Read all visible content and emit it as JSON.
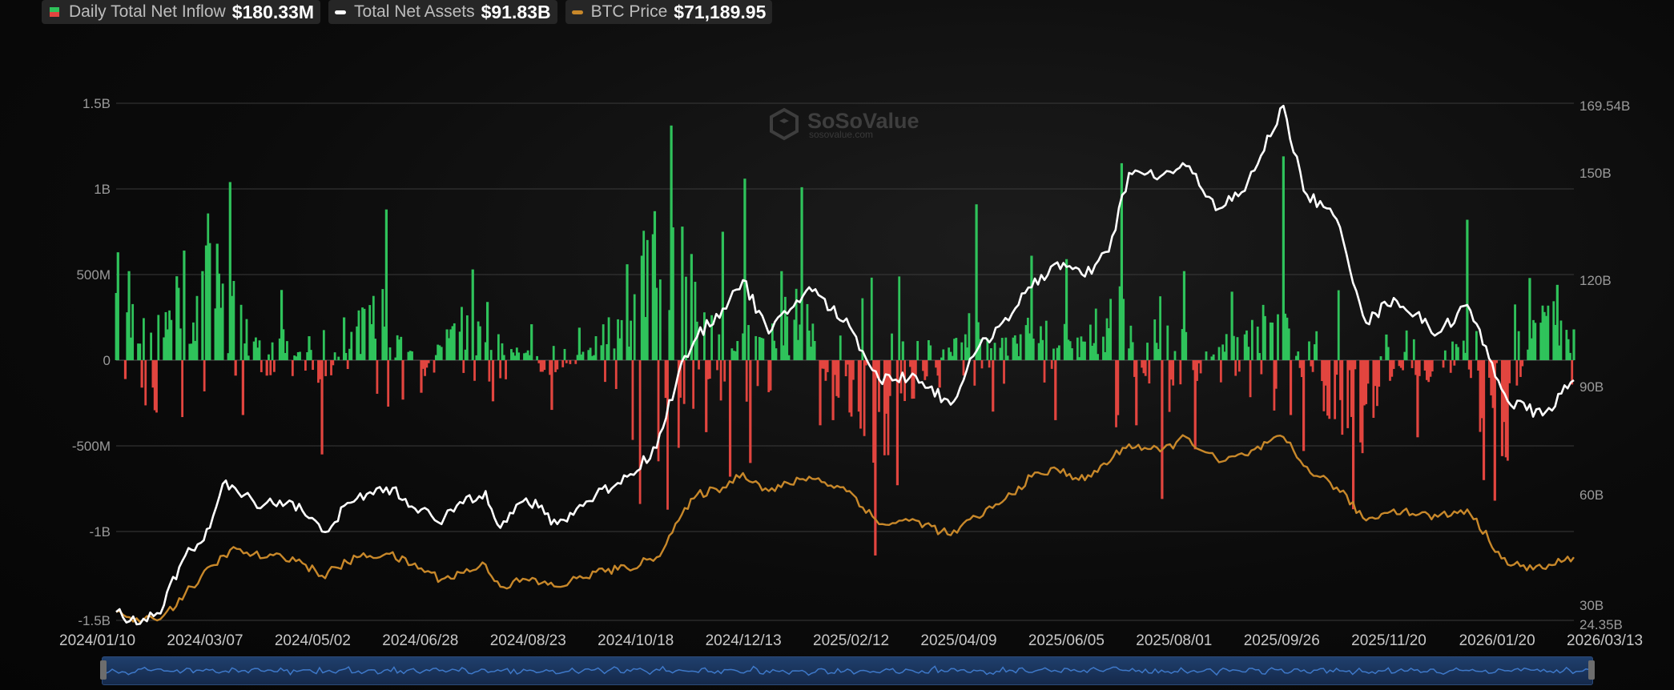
{
  "legend": {
    "inflow_label": "Daily Total Net Inflow",
    "inflow_value": "$180.33M",
    "assets_label": "Total Net Assets",
    "assets_value": "$91.83B",
    "btc_label": "BTC Price",
    "btc_value": "$71,189.95"
  },
  "watermark": {
    "brand": "SoSoValue",
    "site": "sosovalue.com"
  },
  "colors": {
    "positive": "#2fc35b",
    "negative": "#e2453f",
    "assets_line": "#ffffff",
    "btc_line": "#c8882a",
    "grid": "#3a3a3a",
    "navigator": "#1e3c6b"
  },
  "chart_data": {
    "type": "bar",
    "x_axis": {
      "type": "date",
      "range": [
        "2024-01-10",
        "2026-03-13"
      ],
      "tick_labels": [
        "2024/01/10",
        "2024/03/07",
        "2024/05/02",
        "2024/06/28",
        "2024/08/23",
        "2024/10/18",
        "2024/12/13",
        "2025/02/12",
        "2025/04/09",
        "2025/06/05",
        "2025/08/01",
        "2025/09/26",
        "2025/11/20",
        "2026/01/20",
        "2026/03/13"
      ]
    },
    "y_left": {
      "tick_labels": [
        "1.5B",
        "1B",
        "500M",
        "0",
        "-500M",
        "-1B",
        "-1.5B"
      ],
      "range": [
        -1500000000,
        1500000000
      ],
      "unit": "USD"
    },
    "y_right": {
      "tick_labels": [
        "169.54B",
        "150B",
        "120B",
        "90B",
        "60B",
        "30B",
        "24.35B"
      ],
      "range": [
        24.35,
        169.54
      ],
      "unit": "B USD"
    },
    "grid": true,
    "legend_position": "top-left",
    "series": [
      {
        "name": "Daily Total Net Inflow",
        "kind": "bar",
        "axis": "left",
        "unit": "USD M",
        "points": [
          [
            "2024-01-11",
            630
          ],
          [
            "2024-01-15",
            -110
          ],
          [
            "2024-01-17",
            520
          ],
          [
            "2024-01-24",
            -160
          ],
          [
            "2024-02-07",
            180
          ],
          [
            "2024-02-12",
            490
          ],
          [
            "2024-02-16",
            640
          ],
          [
            "2024-02-26",
            520
          ],
          [
            "2024-02-28",
            670
          ],
          [
            "2024-03-05",
            680
          ],
          [
            "2024-03-12",
            1040
          ],
          [
            "2024-03-15",
            -90
          ],
          [
            "2024-03-19",
            -320
          ],
          [
            "2024-04-01",
            -90
          ],
          [
            "2024-04-09",
            410
          ],
          [
            "2024-04-24",
            140
          ],
          [
            "2024-05-01",
            -550
          ],
          [
            "2024-05-13",
            250
          ],
          [
            "2024-05-24",
            300
          ],
          [
            "2024-06-05",
            880
          ],
          [
            "2024-06-14",
            -230
          ],
          [
            "2024-06-24",
            -190
          ],
          [
            "2024-07-08",
            180
          ],
          [
            "2024-07-22",
            530
          ],
          [
            "2024-07-30",
            340
          ],
          [
            "2024-08-02",
            -240
          ],
          [
            "2024-08-23",
            210
          ],
          [
            "2024-09-03",
            -290
          ],
          [
            "2024-09-18",
            190
          ],
          [
            "2024-10-14",
            560
          ],
          [
            "2024-10-22",
            610
          ],
          [
            "2024-10-29",
            870
          ],
          [
            "2024-11-04",
            -220
          ],
          [
            "2024-11-07",
            1370
          ],
          [
            "2024-11-13",
            780
          ],
          [
            "2024-11-18",
            620
          ],
          [
            "2024-11-26",
            -420
          ],
          [
            "2024-12-05",
            750
          ],
          [
            "2024-12-09",
            -680
          ],
          [
            "2024-12-17",
            1060
          ],
          [
            "2024-12-20",
            -600
          ],
          [
            "2025-01-06",
            520
          ],
          [
            "2025-01-17",
            1010
          ],
          [
            "2025-01-27",
            -380
          ],
          [
            "2025-02-03",
            -350
          ],
          [
            "2025-02-26",
            -1140
          ],
          [
            "2025-03-10",
            -730
          ],
          [
            "2025-03-13",
            110
          ],
          [
            "2025-04-02",
            -160
          ],
          [
            "2025-04-22",
            910
          ],
          [
            "2025-05-01",
            -300
          ],
          [
            "2025-05-22",
            610
          ],
          [
            "2025-06-04",
            -350
          ],
          [
            "2025-06-10",
            590
          ],
          [
            "2025-07-10",
            1150
          ],
          [
            "2025-07-18",
            -380
          ],
          [
            "2025-08-01",
            -810
          ],
          [
            "2025-08-13",
            520
          ],
          [
            "2025-08-19",
            -520
          ],
          [
            "2025-09-08",
            400
          ],
          [
            "2025-10-06",
            1190
          ],
          [
            "2025-10-10",
            -320
          ],
          [
            "2025-10-17",
            -530
          ],
          [
            "2025-11-13",
            -870
          ],
          [
            "2025-11-17",
            -480
          ],
          [
            "2025-12-01",
            150
          ],
          [
            "2025-12-18",
            -450
          ],
          [
            "2026-01-14",
            820
          ],
          [
            "2026-01-23",
            -700
          ],
          [
            "2026-01-29",
            -820
          ],
          [
            "2026-02-02",
            -560
          ],
          [
            "2026-02-17",
            480
          ],
          [
            "2026-03-04",
            440
          ],
          [
            "2026-03-13",
            180
          ]
        ]
      },
      {
        "name": "Total Net Assets",
        "kind": "line",
        "axis": "right",
        "unit": "B USD",
        "points": [
          [
            "2024-01-10",
            28
          ],
          [
            "2024-01-23",
            24.5
          ],
          [
            "2024-02-05",
            30
          ],
          [
            "2024-02-15",
            42
          ],
          [
            "2024-03-01",
            51
          ],
          [
            "2024-03-08",
            63
          ],
          [
            "2024-03-25",
            58
          ],
          [
            "2024-04-15",
            58
          ],
          [
            "2024-05-01",
            50
          ],
          [
            "2024-05-20",
            59
          ],
          [
            "2024-06-05",
            62
          ],
          [
            "2024-06-24",
            56
          ],
          [
            "2024-07-05",
            52
          ],
          [
            "2024-07-15",
            58
          ],
          [
            "2024-07-29",
            61
          ],
          [
            "2024-08-06",
            51
          ],
          [
            "2024-08-20",
            59
          ],
          [
            "2024-09-06",
            52
          ],
          [
            "2024-09-27",
            60
          ],
          [
            "2024-10-14",
            65
          ],
          [
            "2024-10-30",
            73
          ],
          [
            "2024-11-11",
            94
          ],
          [
            "2024-11-21",
            104
          ],
          [
            "2024-12-05",
            112
          ],
          [
            "2024-12-16",
            120
          ],
          [
            "2024-12-30",
            105
          ],
          [
            "2025-01-21",
            118
          ],
          [
            "2025-02-12",
            107
          ],
          [
            "2025-02-28",
            92
          ],
          [
            "2025-03-20",
            93
          ],
          [
            "2025-04-08",
            85
          ],
          [
            "2025-04-22",
            100
          ],
          [
            "2025-05-06",
            108
          ],
          [
            "2025-05-22",
            118
          ],
          [
            "2025-06-05",
            125
          ],
          [
            "2025-06-20",
            121
          ],
          [
            "2025-07-03",
            128
          ],
          [
            "2025-07-14",
            150
          ],
          [
            "2025-07-31",
            149
          ],
          [
            "2025-08-14",
            152
          ],
          [
            "2025-09-01",
            140
          ],
          [
            "2025-09-15",
            145
          ],
          [
            "2025-10-06",
            169.5
          ],
          [
            "2025-10-17",
            145
          ],
          [
            "2025-11-04",
            137
          ],
          [
            "2025-11-20",
            108
          ],
          [
            "2025-12-05",
            115
          ],
          [
            "2025-12-29",
            105
          ],
          [
            "2026-01-14",
            113
          ],
          [
            "2026-02-05",
            86
          ],
          [
            "2026-02-24",
            82
          ],
          [
            "2026-03-13",
            91.83
          ]
        ]
      },
      {
        "name": "BTC Price",
        "kind": "line",
        "axis": "right",
        "unit": "relative",
        "points": [
          [
            "2024-01-10",
            28
          ],
          [
            "2024-01-23",
            25
          ],
          [
            "2024-02-05",
            27
          ],
          [
            "2024-02-20",
            35
          ],
          [
            "2024-03-12",
            45
          ],
          [
            "2024-04-01",
            43
          ],
          [
            "2024-04-15",
            43
          ],
          [
            "2024-05-01",
            38
          ],
          [
            "2024-05-20",
            43
          ],
          [
            "2024-06-05",
            44
          ],
          [
            "2024-06-24",
            40
          ],
          [
            "2024-07-05",
            37
          ],
          [
            "2024-07-29",
            41
          ],
          [
            "2024-08-06",
            35
          ],
          [
            "2024-08-20",
            37
          ],
          [
            "2024-09-06",
            35
          ],
          [
            "2024-09-27",
            39
          ],
          [
            "2024-10-14",
            40
          ],
          [
            "2024-10-30",
            43
          ],
          [
            "2024-11-11",
            53
          ],
          [
            "2024-11-21",
            60
          ],
          [
            "2024-12-05",
            62
          ],
          [
            "2024-12-16",
            66
          ],
          [
            "2024-12-30",
            61
          ],
          [
            "2025-01-21",
            65
          ],
          [
            "2025-02-12",
            61
          ],
          [
            "2025-02-28",
            52
          ],
          [
            "2025-03-20",
            53
          ],
          [
            "2025-04-08",
            49
          ],
          [
            "2025-04-22",
            54
          ],
          [
            "2025-05-06",
            58
          ],
          [
            "2025-05-22",
            65
          ],
          [
            "2025-06-05",
            67
          ],
          [
            "2025-06-20",
            64
          ],
          [
            "2025-07-14",
            74
          ],
          [
            "2025-07-31",
            72
          ],
          [
            "2025-08-14",
            76
          ],
          [
            "2025-09-01",
            69
          ],
          [
            "2025-09-15",
            71
          ],
          [
            "2025-10-06",
            76
          ],
          [
            "2025-10-17",
            68
          ],
          [
            "2025-11-04",
            62
          ],
          [
            "2025-11-20",
            53
          ],
          [
            "2025-12-05",
            56
          ],
          [
            "2025-12-29",
            54
          ],
          [
            "2026-01-14",
            56
          ],
          [
            "2026-02-05",
            41
          ],
          [
            "2026-02-24",
            40
          ],
          [
            "2026-03-13",
            43
          ]
        ]
      }
    ]
  }
}
